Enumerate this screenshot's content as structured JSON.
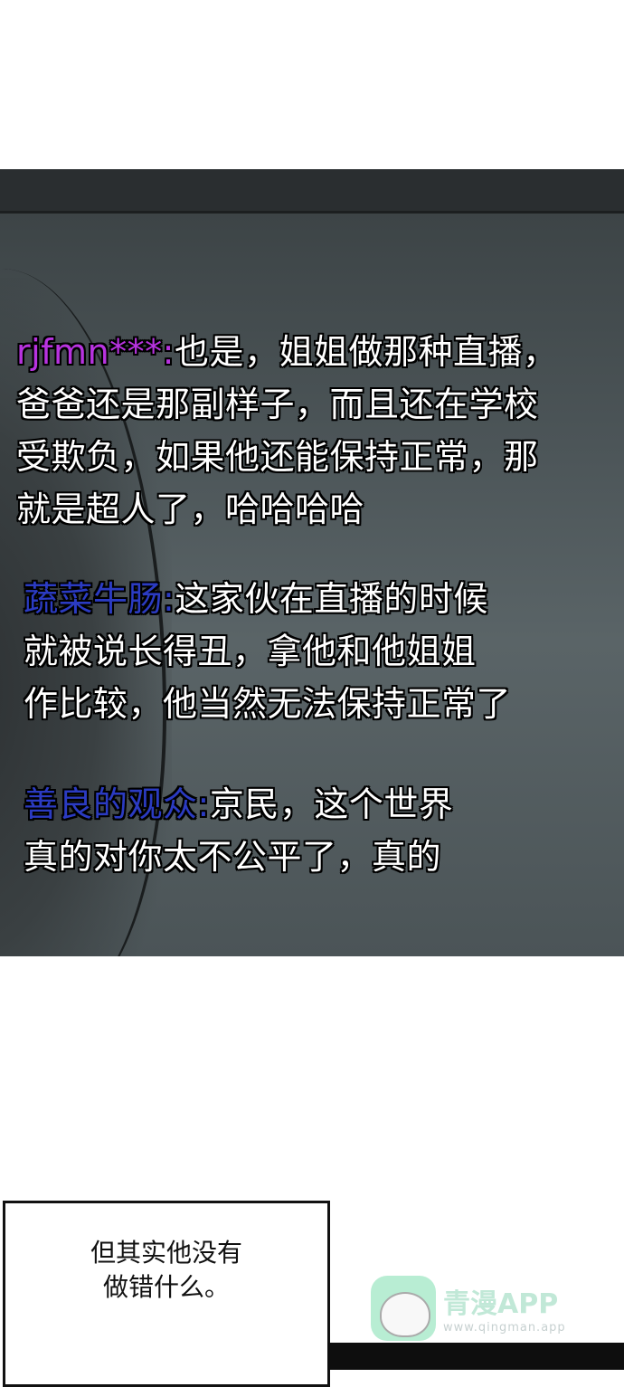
{
  "comments": [
    {
      "user": "rjfmn***",
      "user_color": "#b833e0",
      "separator": ":",
      "lines": [
        "也是，姐姐做那种直播，",
        "爸爸还是那副样子，而且还在学校",
        "受欺负，如果他还能保持正常，那",
        "就是超人了，哈哈哈哈"
      ]
    },
    {
      "user": "蔬菜牛肠",
      "user_color": "#2b3bc2",
      "separator": ":",
      "lines": [
        "这家伙在直播的时候",
        "就被说长得丑，拿他和他姐姐",
        "作比较，他当然无法保持正常了"
      ]
    },
    {
      "user": "善良的观众",
      "user_color": "#2b3bc2",
      "separator": ":",
      "lines": [
        "京民，这个世界",
        "真的对你太不公平了，真的"
      ]
    }
  ],
  "caption": {
    "lines": [
      "但其实他没有",
      "做错什么。"
    ]
  },
  "watermark": {
    "title": "青漫APP",
    "url": "www.qingman.app",
    "icon": "cat-logo-icon"
  }
}
